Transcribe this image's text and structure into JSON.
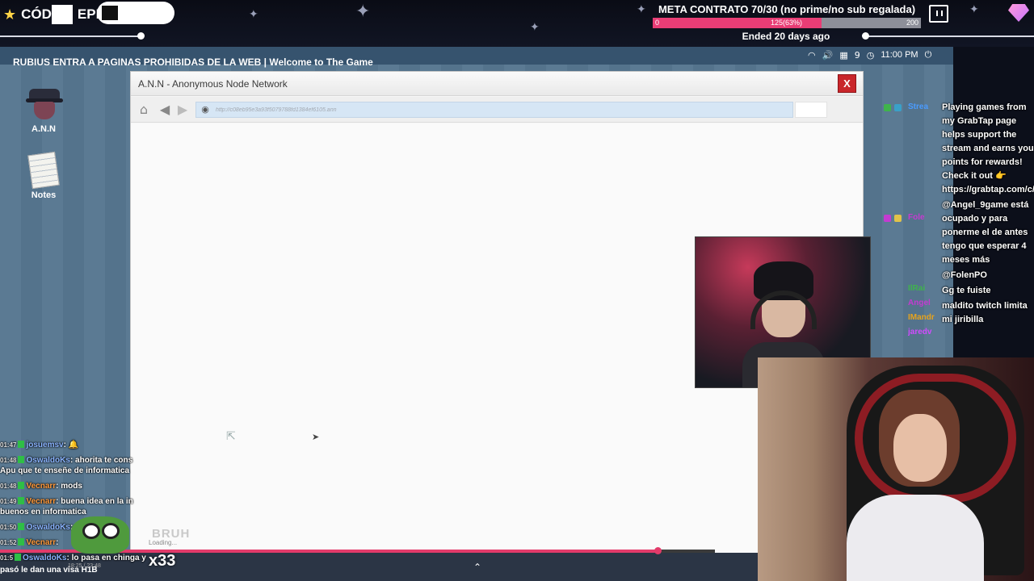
{
  "topbar": {
    "brand_left": "CÓD",
    "brand_right": "EPIC",
    "meta_title": "META CONTRATO 70/30 (no prime/no sub regalada)",
    "meta_min": "0",
    "meta_value_label": "125(63%)",
    "meta_max": "200",
    "meta_progress": 0.63,
    "ended": "Ended 20 days ago",
    "icons": [
      "star-icon",
      "twitch-icon",
      "gem-icon"
    ]
  },
  "game": {
    "title": "RUBIUS ENTRA A PAGINAS PROHIBIDAS DE LA WEB | Welcome to The Game",
    "tray": {
      "count": "9",
      "clock": "11:00 PM"
    },
    "desktop_icons": [
      {
        "label": "A.N.N"
      },
      {
        "label": "Notes"
      }
    ]
  },
  "browser": {
    "title": "A.N.N - Anonymous Node Network",
    "close_label": "X",
    "url": "http://c08eb95e3a93f5079788fd1384ef6105.ann",
    "loading": "Loading..."
  },
  "player": {
    "progress": 0.92
  },
  "left_chat": {
    "messages": [
      {
        "time": "01:47",
        "user": "josuemsv",
        "text": "",
        "color": "n-blue"
      },
      {
        "time": "01:48",
        "user": "OswaldoKs",
        "text": "ahorita te cons",
        "color": "n-blue"
      },
      {
        "time": "",
        "user": "",
        "text": "Apu que te enseñe de informatica",
        "color": ""
      },
      {
        "time": "01:48",
        "user": "Vecnarr",
        "text": "mods",
        "color": "n-orange"
      },
      {
        "time": "01:49",
        "user": "Vecnarr",
        "text": "buena idea en la in",
        "color": "n-orange"
      },
      {
        "time": "",
        "user": "",
        "text": "buenos en informatica",
        "color": ""
      },
      {
        "time": "01:50",
        "user": "OswaldoKs",
        "text": "",
        "color": "n-blue"
      },
      {
        "time": "01:52",
        "user": "Vecnarr",
        "text": "",
        "color": "n-orange"
      },
      {
        "time": "01:5",
        "user": "OswaldoKs",
        "text": "lo pasa en chinga y",
        "color": "n-blue"
      }
    ],
    "last_line": "pasó le dan una visa H1B",
    "emote_text": "BRUH",
    "combo": "x33",
    "stamp": "18:25 / 23:48"
  },
  "right_chat": {
    "names": [
      {
        "name": "Strea",
        "color": "#4a9bff"
      },
      {
        "name": "Fole",
        "color": "#c43bd1"
      },
      {
        "name": "IlRai",
        "color": "#3fb44b"
      },
      {
        "name": "Angel",
        "color": "#c43bd1"
      },
      {
        "name": "IMandr",
        "color": "#e6a31d"
      },
      {
        "name": "jaredv",
        "color": "#d14bff"
      }
    ],
    "messages": [
      "Playing games from my GrabTap page helps support the stream and earns you points for rewards! Check it out 👉 https://grabtap.com/c/welchelas",
      "@Angel_9game está ocupado y para ponerme el de antes tengo que esperar 4 meses más",
      "@FolenPO",
      "Gg te fuiste",
      "maldito twitch limita mi jiribilla"
    ]
  }
}
